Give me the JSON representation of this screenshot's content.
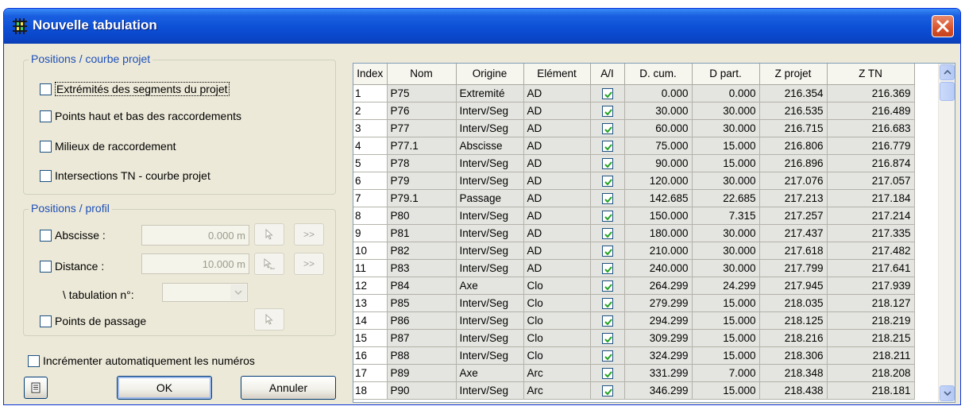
{
  "window": {
    "title": "Nouvelle tabulation"
  },
  "group_courbe": {
    "legend": "Positions / courbe projet",
    "items": [
      {
        "label": "Extrémités des segments du projet",
        "checked": false
      },
      {
        "label": "Points haut et bas des raccordements",
        "checked": false
      },
      {
        "label": "Milieux de raccordement",
        "checked": false
      },
      {
        "label": "Intersections TN - courbe projet",
        "checked": false
      }
    ]
  },
  "group_profil": {
    "legend": "Positions / profil",
    "abscisse_label": "Abscisse :",
    "abscisse_value": "0.000 m",
    "distance_label": "Distance :",
    "distance_value": "10.000 m",
    "tabulation_label": "\\ tabulation n°:",
    "tabulation_value": "",
    "passage_label": "Points de passage",
    "next_label": ">>"
  },
  "increment_label": "Incrémenter automatiquement les numéros",
  "buttons": {
    "ok": "OK",
    "cancel": "Annuler"
  },
  "table": {
    "columns": [
      "Index",
      "Nom",
      "Origine",
      "Elément",
      "A/I",
      "D. cum.",
      "D part.",
      "Z projet",
      "Z TN"
    ],
    "rows": [
      [
        "1",
        "P75",
        "Extremité",
        "AD",
        true,
        "0.000",
        "0.000",
        "216.354",
        "216.369"
      ],
      [
        "2",
        "P76",
        "Interv/Seg",
        "AD",
        true,
        "30.000",
        "30.000",
        "216.535",
        "216.489"
      ],
      [
        "3",
        "P77",
        "Interv/Seg",
        "AD",
        true,
        "60.000",
        "30.000",
        "216.715",
        "216.683"
      ],
      [
        "4",
        "P77.1",
        "Abscisse",
        "AD",
        true,
        "75.000",
        "15.000",
        "216.806",
        "216.779"
      ],
      [
        "5",
        "P78",
        "Interv/Seg",
        "AD",
        true,
        "90.000",
        "15.000",
        "216.896",
        "216.874"
      ],
      [
        "6",
        "P79",
        "Interv/Seg",
        "AD",
        true,
        "120.000",
        "30.000",
        "217.076",
        "217.057"
      ],
      [
        "7",
        "P79.1",
        "Passage",
        "AD",
        true,
        "142.685",
        "22.685",
        "217.213",
        "217.184"
      ],
      [
        "8",
        "P80",
        "Interv/Seg",
        "AD",
        true,
        "150.000",
        "7.315",
        "217.257",
        "217.214"
      ],
      [
        "9",
        "P81",
        "Interv/Seg",
        "AD",
        true,
        "180.000",
        "30.000",
        "217.437",
        "217.335"
      ],
      [
        "10",
        "P82",
        "Interv/Seg",
        "AD",
        true,
        "210.000",
        "30.000",
        "217.618",
        "217.482"
      ],
      [
        "11",
        "P83",
        "Interv/Seg",
        "AD",
        true,
        "240.000",
        "30.000",
        "217.799",
        "217.641"
      ],
      [
        "12",
        "P84",
        "Axe",
        "Clo",
        true,
        "264.299",
        "24.299",
        "217.945",
        "217.939"
      ],
      [
        "13",
        "P85",
        "Interv/Seg",
        "Clo",
        true,
        "279.299",
        "15.000",
        "218.035",
        "218.127"
      ],
      [
        "14",
        "P86",
        "Interv/Seg",
        "Clo",
        true,
        "294.299",
        "15.000",
        "218.125",
        "218.219"
      ],
      [
        "15",
        "P87",
        "Interv/Seg",
        "Clo",
        true,
        "309.299",
        "15.000",
        "218.216",
        "218.215"
      ],
      [
        "16",
        "P88",
        "Interv/Seg",
        "Clo",
        true,
        "324.299",
        "15.000",
        "218.306",
        "218.211"
      ],
      [
        "17",
        "P89",
        "Axe",
        "Arc",
        true,
        "331.299",
        "7.000",
        "218.348",
        "218.208"
      ],
      [
        "18",
        "P90",
        "Interv/Seg",
        "Arc",
        true,
        "346.299",
        "15.000",
        "218.438",
        "218.181"
      ]
    ]
  }
}
